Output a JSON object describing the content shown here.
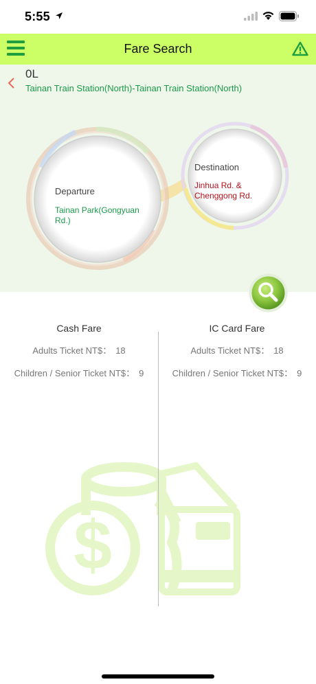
{
  "status_bar": {
    "time": "5:55"
  },
  "nav": {
    "title": "Fare Search",
    "menu_icon": "hamburger-menu-icon",
    "right_icon": "warning-triangle-icon"
  },
  "route": {
    "id": "0L",
    "name": "Tainan Train Station(North)-Tainan Train Station(North)"
  },
  "departure": {
    "label": "Departure",
    "value": "Tainan Park(Gongyuan Rd.)"
  },
  "destination": {
    "label": "Destination",
    "value": "Jinhua Rd. & Chenggong Rd."
  },
  "cash_fare": {
    "title": "Cash Fare",
    "adult_label": "Adults Ticket NT$：",
    "adult_value": "18",
    "child_label": "Children / Senior Ticket NT$：",
    "child_value": "9"
  },
  "ic_fare": {
    "title": "IC Card Fare",
    "adult_label": "Adults Ticket NT$：",
    "adult_value": "18",
    "child_label": "Children / Senior Ticket NT$：",
    "child_value": "9"
  },
  "colors": {
    "nav_bg": "#ccff66",
    "accent_green": "#1a9a4a",
    "destination_red": "#b5121b",
    "panel_bg": "#eef7ea"
  }
}
